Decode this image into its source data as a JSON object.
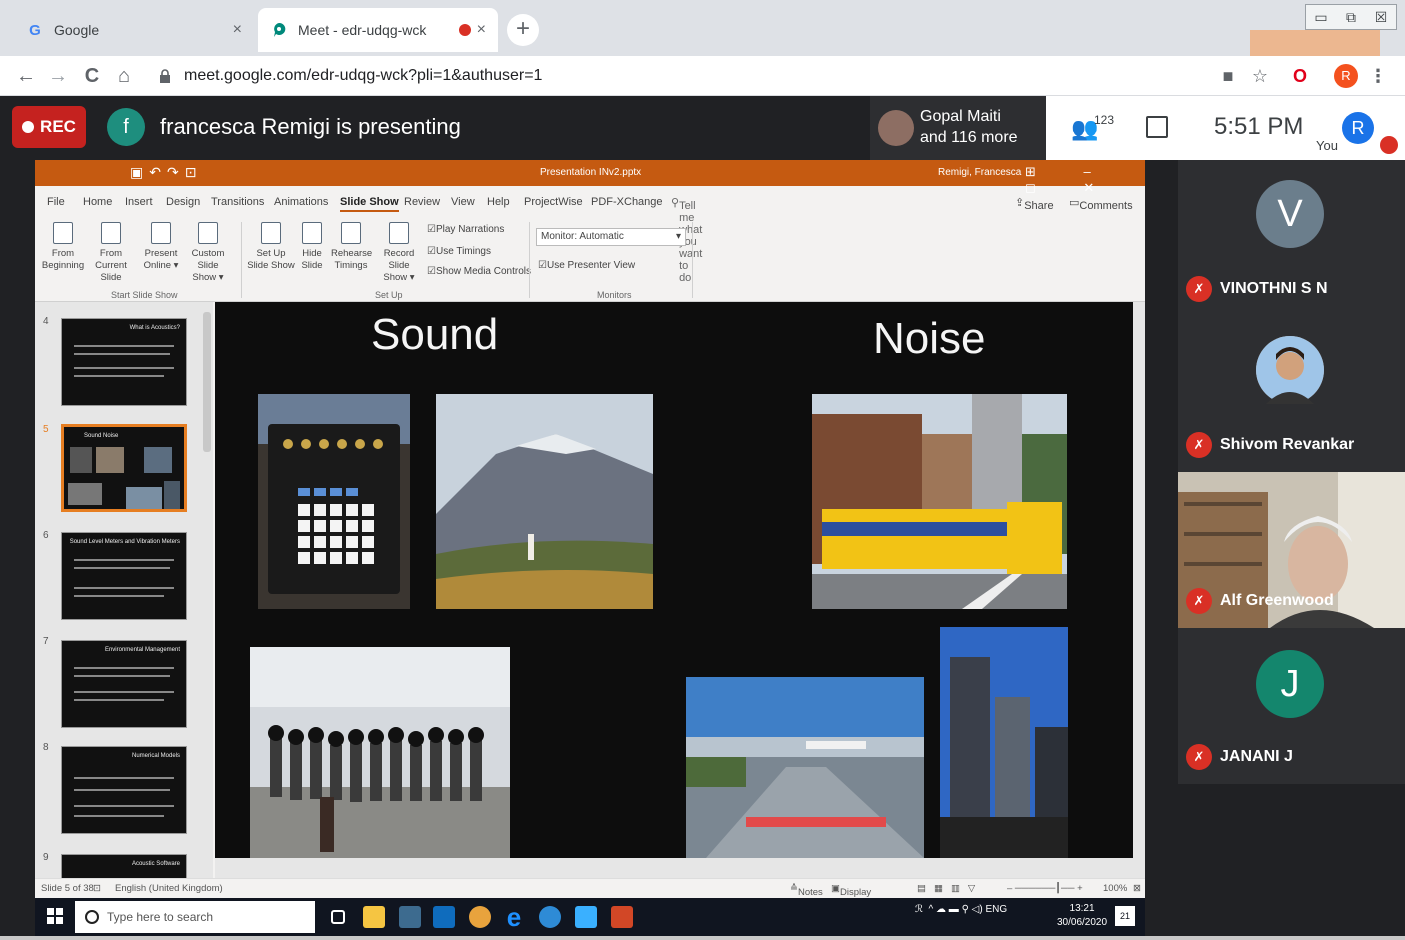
{
  "browser": {
    "tabs": [
      {
        "icon": "google-g-icon",
        "title": "Google",
        "close": "×"
      },
      {
        "icon": "meet-icon",
        "title": "Meet - edr-udqg-wck",
        "close": "×"
      }
    ],
    "new_tab": "+",
    "window_controls": [
      "▭",
      "⧉",
      "☒"
    ],
    "nav": {
      "back": "←",
      "forward": "→",
      "reload": "C",
      "home": "⌂"
    },
    "url": "meet.google.com/edr-udqg-wck?pli=1&authuser=1",
    "profile_initial": "R"
  },
  "meet": {
    "rec_label": "REC",
    "presenter_initial": "f",
    "presenting_text": "francesca Remigi is presenting",
    "pinned_name_line1": "Gopal Maiti",
    "pinned_name_line2": "and 116 more",
    "participant_count": "123",
    "time": "5:51 PM",
    "you_label": "You",
    "self_initial": "R"
  },
  "ppt": {
    "title_file": "Presentation INv2.pptx",
    "title_user": "Remigi, Francesca",
    "menus": [
      "File",
      "Home",
      "Insert",
      "Design",
      "Transitions",
      "Animations",
      "Slide Show",
      "Review",
      "View",
      "Help",
      "ProjectWise",
      "PDF-XChange"
    ],
    "tell_me": "Tell me what you want to do",
    "share": "Share",
    "comments": "Comments",
    "ribbon_buttons": [
      {
        "l1": "From",
        "l2": "Beginning"
      },
      {
        "l1": "From",
        "l2": "Current Slide"
      },
      {
        "l1": "Present",
        "l2": "Online ▾"
      },
      {
        "l1": "Custom Slide",
        "l2": "Show ▾"
      },
      {
        "l1": "Set Up",
        "l2": "Slide Show"
      },
      {
        "l1": "Hide",
        "l2": "Slide"
      },
      {
        "l1": "Rehearse",
        "l2": "Timings"
      },
      {
        "l1": "Record Slide",
        "l2": "Show ▾"
      }
    ],
    "checkboxes": [
      "Play Narrations",
      "Use Timings",
      "Show Media Controls"
    ],
    "monitor_label": "Monitor:",
    "monitor_value": "Automatic",
    "presenter_view": "Use Presenter View",
    "groups": [
      "Start Slide Show",
      "Set Up",
      "Monitors"
    ],
    "thumbnails": [
      {
        "num": "4",
        "title": "What is Acoustics?"
      },
      {
        "num": "5",
        "title": "Sound        Noise"
      },
      {
        "num": "6",
        "title": "Sound Level Meters and Vibration Meters"
      },
      {
        "num": "7",
        "title": "Environmental Management"
      },
      {
        "num": "8",
        "title": "Numerical Models"
      },
      {
        "num": "9",
        "title": "Acoustic Software"
      }
    ],
    "slide": {
      "heading_left": "Sound",
      "heading_right": "Noise"
    },
    "status": {
      "slide_of": "Slide 5 of 38",
      "language": "English (United Kingdom)",
      "notes": "Notes",
      "display_settings": "Display Settings",
      "zoom": "100%"
    }
  },
  "taskbar": {
    "search_placeholder": "Type here to search",
    "lang": "ENG",
    "clock_time": "13:21",
    "clock_date": "30/06/2020",
    "notif_count": "21"
  },
  "participants": [
    {
      "name": "VINOTHNI S N",
      "initial": "V",
      "color": "#6b7e8c"
    },
    {
      "name": "Shivom Revankar",
      "initial": "",
      "color": "#c9a07a"
    },
    {
      "name": "Alf Greenwood",
      "initial": "",
      "color": "#8a7a66"
    },
    {
      "name": "JANANI J",
      "initial": "J",
      "color": "#14866d"
    }
  ]
}
